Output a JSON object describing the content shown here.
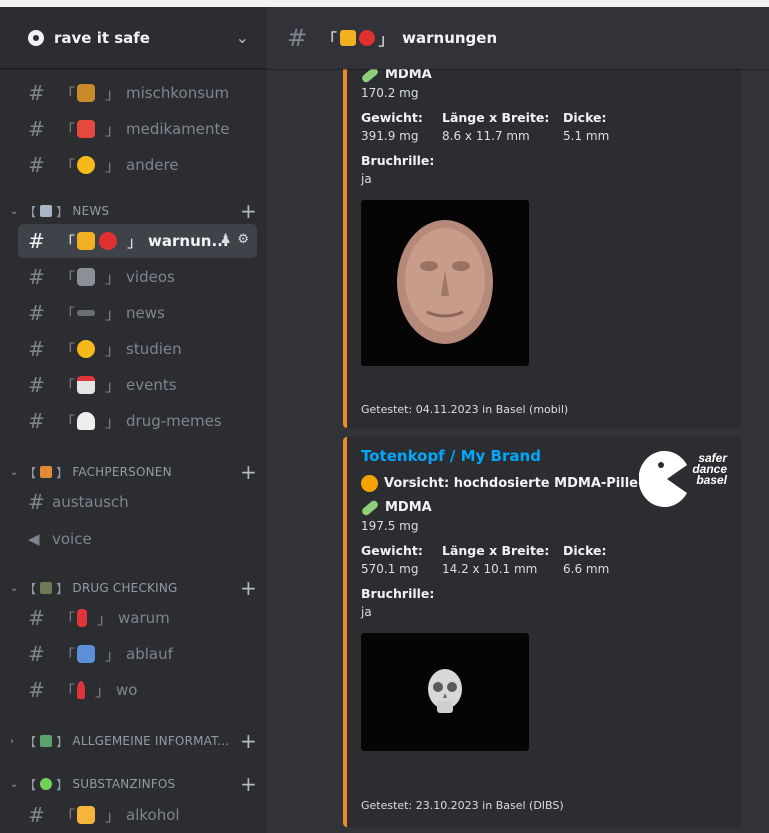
{
  "server": {
    "name": "rave it safe",
    "icon": "server-icon"
  },
  "channels_top": [
    {
      "name": "mischkonsum",
      "emoji_color": "#c98a2a",
      "icon": "hash-icon"
    },
    {
      "name": "medikamente",
      "emoji_color": "#e5483c",
      "icon": "hash-icon"
    },
    {
      "name": "andere",
      "emoji_color": "#f5b91c",
      "icon": "hash-icon"
    }
  ],
  "categories": {
    "news": {
      "name": "NEWS",
      "emoji_color": "#a9b5c6"
    },
    "fachpersonen": {
      "name": "FACHPERSONEN",
      "emoji_color": "#e08a3a"
    },
    "drug_checking": {
      "name": "DRUG CHECKING",
      "emoji_color": "#6d7a56"
    },
    "allgemeine": {
      "name": "ALLGEMEINE INFORMAT...",
      "emoji_color": "#5aa46b"
    },
    "substanzinfos": {
      "name": "SUBSTANZINFOS",
      "emoji_color": "#6fd35a"
    }
  },
  "news_channels": [
    {
      "name": "warnun...",
      "active": true
    },
    {
      "name": "videos",
      "emoji_color": "#8b8f98"
    },
    {
      "name": "news",
      "emoji_color": "#c9d1d9"
    },
    {
      "name": "studien",
      "emoji_color": "#f5b91c"
    },
    {
      "name": "events",
      "emoji_color": "#e5e5e5"
    },
    {
      "name": "drug-memes",
      "emoji_color": "#eeeeee"
    }
  ],
  "fach_channels": [
    {
      "name": "austausch",
      "type": "thread"
    },
    {
      "name": "voice",
      "type": "voice"
    }
  ],
  "check_channels": [
    {
      "name": "warum",
      "emoji_color": "#e0343a"
    },
    {
      "name": "ablauf",
      "emoji_color": "#5b8fd8"
    },
    {
      "name": "wo",
      "emoji_color": "#e0343a"
    }
  ],
  "substanz_channels": [
    {
      "name": "alkohol",
      "emoji_color": "#f5b43a"
    }
  ],
  "header": {
    "channel_name": "warnungen",
    "bracket_open": "「",
    "bracket_close": "」"
  },
  "embeds": [
    {
      "substance": "MDMA",
      "amount": "170.2 mg",
      "fields": [
        {
          "label": "Gewicht:",
          "value": "391.9 mg"
        },
        {
          "label": "Länge x Breite:",
          "value": "8.6 x 11.7 mm"
        },
        {
          "label": "Dicke:",
          "value": "5.1 mm"
        }
      ],
      "bruch_label": "Bruchrille:",
      "bruch_value": "ja",
      "footer": "Getestet: 04.11.2023 in Basel (mobil)"
    },
    {
      "title": "Totenkopf / My Brand",
      "warning": "Vorsicht: hochdosierte MDMA-Pille",
      "substance": "MDMA",
      "amount": "197.5 mg",
      "fields": [
        {
          "label": "Gewicht:",
          "value": "570.1 mg"
        },
        {
          "label": "Länge x Breite:",
          "value": "14.2 x 10.1 mm"
        },
        {
          "label": "Dicke:",
          "value": "6.6 mm"
        }
      ],
      "bruch_label": "Bruchrille:",
      "bruch_value": "ja",
      "footer": "Getestet: 23.10.2023 in Basel (DIBS)",
      "logo_text": [
        "safer",
        "dance",
        "basel"
      ]
    }
  ],
  "colors": {
    "accent_border": "#f08a24",
    "link": "#00a8fc",
    "warning_dot": "#f5a300"
  }
}
